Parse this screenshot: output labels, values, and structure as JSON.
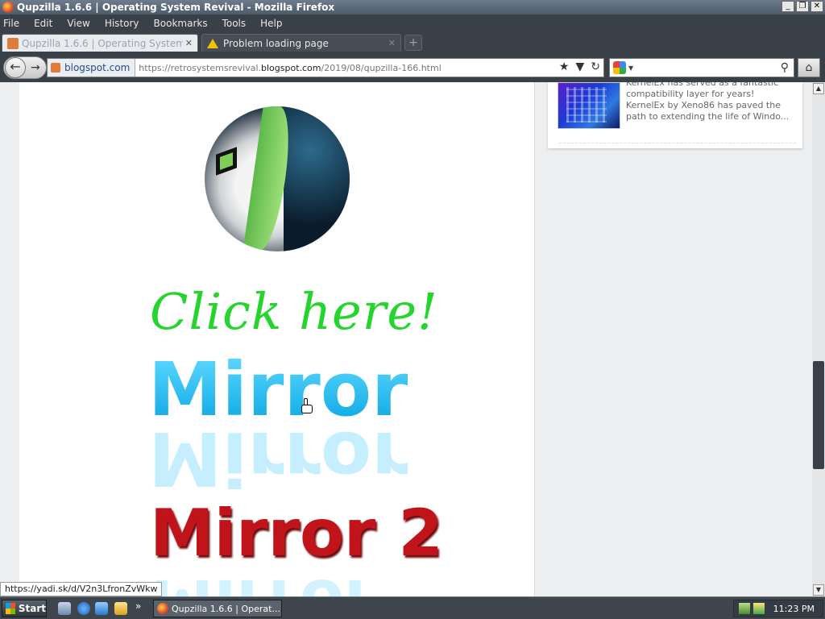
{
  "window": {
    "title": "Qupzilla 1.6.6 | Operating System Revival - Mozilla Firefox",
    "buttons": [
      "_",
      "❐",
      "✕"
    ]
  },
  "menu": [
    "File",
    "Edit",
    "View",
    "History",
    "Bookmarks",
    "Tools",
    "Help"
  ],
  "tabs": [
    {
      "label": "Qupzilla 1.6.6 | Operating System Revival",
      "active": true
    },
    {
      "label": "Problem loading page",
      "active": false
    }
  ],
  "newtab_label": "+",
  "nav": {
    "identity_label": "blogspot.com",
    "url_prefix": "https://retrosystemsrevival.",
    "url_domain": "blogspot.com",
    "url_path": "/2019/08/qupzilla-166.html"
  },
  "content": {
    "click_here": "Click here!",
    "mirror1": "Mirror",
    "mirror2": "Mirror 2"
  },
  "sidebar": {
    "snippet": "KernelEx has served as a fantastic compatibility layer for years! KernelEx by Xeno86 has paved the path to extending the life of Windo..."
  },
  "status_link": "https://yadi.sk/d/V2n3LfronZvWkw",
  "taskbar": {
    "start_label": "Start",
    "task_label": "Qupzilla 1.6.6 | Operat...",
    "clock": "11:23 PM",
    "chevron": "»"
  },
  "colors": {
    "click_here": "#25d52d",
    "mirror": "#10b8ec",
    "mirror2": "#c0141a"
  }
}
